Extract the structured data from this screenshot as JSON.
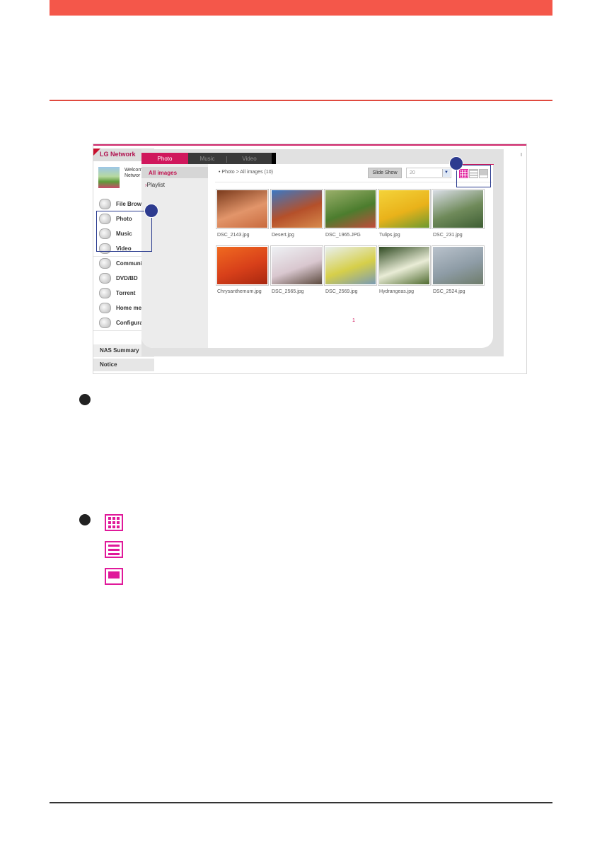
{
  "app": {
    "brand": "LG Network",
    "welcome": [
      "Welcom",
      "Networ"
    ],
    "menu": [
      {
        "label": "File Brow",
        "icon": "folder-icon"
      },
      {
        "label": "Photo",
        "icon": "camera-icon"
      },
      {
        "label": "Music",
        "icon": "music-icon"
      },
      {
        "label": "Video",
        "icon": "film-reel-icon"
      },
      {
        "label": "Communi",
        "icon": "community-icon"
      },
      {
        "label": "DVD/BD",
        "icon": "play-disc-icon"
      },
      {
        "label": "Torrent",
        "icon": "torrent-icon"
      },
      {
        "label": "Home me",
        "icon": "webcam-icon"
      },
      {
        "label": "Configura",
        "icon": "gear-icon"
      }
    ],
    "nas_summary": "NAS Summary",
    "notice": "Notice",
    "right_tag": "I"
  },
  "photo_panel": {
    "tabs": [
      {
        "label": "Photo",
        "active": true
      },
      {
        "label": "Music",
        "active": false
      },
      {
        "label": "Video",
        "active": false
      }
    ],
    "sidebar": {
      "active": "All images",
      "items": [
        "Playlist"
      ]
    },
    "breadcrumb": "Photo > All images (10)",
    "slideshow_label": "Slide Show",
    "per_page_value": "20",
    "view_modes": [
      "thumbnail-grid-view",
      "list-view",
      "single-view"
    ],
    "images": [
      {
        "caption": "DSC_2143.jpg",
        "colors": [
          "#7a3a1c",
          "#e2956a",
          "#c86a3e"
        ]
      },
      {
        "caption": "Desert.jpg",
        "colors": [
          "#3b78c4",
          "#b5502a",
          "#d78a4c"
        ]
      },
      {
        "caption": "DSC_1965.JPG",
        "colors": [
          "#9aaf6a",
          "#4c7d2e",
          "#c24a3a"
        ]
      },
      {
        "caption": "Tulips.jpg",
        "colors": [
          "#f4d33a",
          "#e9b21a",
          "#6c9a30"
        ]
      },
      {
        "caption": "DSC_231.jpg",
        "colors": [
          "#d9dde6",
          "#6f8a5a",
          "#3e5e34"
        ]
      },
      {
        "caption": "Chrysanthemum.jpg",
        "colors": [
          "#f06a20",
          "#d8401a",
          "#a82810"
        ]
      },
      {
        "caption": "DSC_2565.jpg",
        "colors": [
          "#eef1f4",
          "#d9c7cf",
          "#5c4a3e"
        ]
      },
      {
        "caption": "DSC_2569.jpg",
        "colors": [
          "#e9f0ef",
          "#d6cf4a",
          "#7a9bb4"
        ]
      },
      {
        "caption": "Hydrangeas.jpg",
        "colors": [
          "#2f4a22",
          "#e9ecd6",
          "#4f6b30"
        ]
      },
      {
        "caption": "DSC_2524.jpg",
        "colors": [
          "#b9c2cc",
          "#8e9ca6",
          "#6e7c6a"
        ]
      }
    ],
    "page": "1"
  },
  "colors": {
    "accent": "#d0175c",
    "icon_accent": "#e0199a",
    "header_band": "#f4574a",
    "callout": "#2d3b8f"
  }
}
